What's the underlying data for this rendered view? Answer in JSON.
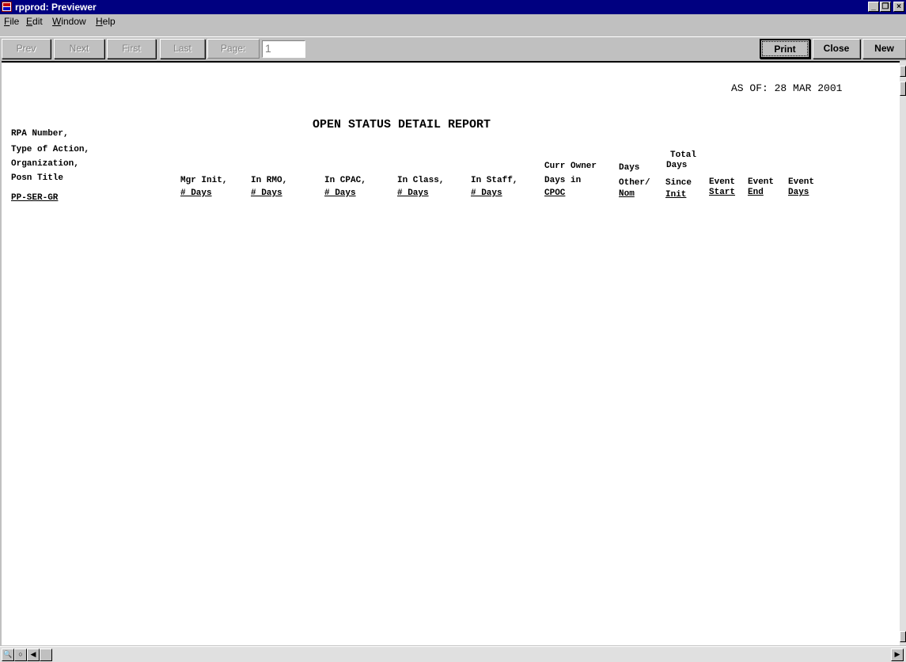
{
  "window": {
    "title": "rpprod: Previewer",
    "controls": {
      "minimize": "_",
      "restore": "❐",
      "close": "×"
    }
  },
  "menu": [
    {
      "label": "File",
      "accel": "F",
      "rest": "ile"
    },
    {
      "label": "Edit",
      "accel": "E",
      "rest": "dit"
    },
    {
      "label": "Window",
      "accel": "W",
      "rest": "indow"
    },
    {
      "label": "Help",
      "accel": "H",
      "rest": "elp"
    }
  ],
  "toolbar": {
    "prev": "Prev",
    "next": "Next",
    "first": "First",
    "last": "Last",
    "page_label": "Page:",
    "page_value": "1",
    "print": "Print",
    "close": "Close",
    "new": "New"
  },
  "report": {
    "as_of": "AS OF:  28 MAR 2001",
    "title": "OPEN STATUS DETAIL REPORT",
    "left_headers": [
      "RPA Number,",
      "Type of Action,",
      "Organization,",
      "Posn Title",
      "PP-SER-GR"
    ],
    "columns": [
      {
        "line1": "Mgr Init,",
        "line2": "# Days"
      },
      {
        "line1": "In RMO,",
        "line2": "# Days"
      },
      {
        "line1": "In CPAC,",
        "line2": "# Days"
      },
      {
        "line1": "In Class,",
        "line2": "# Days"
      },
      {
        "line1": "In Staff,",
        "line2": "# Days"
      },
      {
        "line0": "Curr Owner",
        "line1": "Days in",
        "line2": "CPOC"
      },
      {
        "line0": "Days",
        "line1": "Other/",
        "line2": "Nom"
      },
      {
        "line00": "Total",
        "line0": "Days",
        "line1": "Since",
        "line2": "Init"
      },
      {
        "line1": "Event",
        "line2": "Start"
      },
      {
        "line1": "Event",
        "line2": "End"
      },
      {
        "line1": "Event",
        "line2": "Days"
      }
    ]
  },
  "statusbar": {
    "zoom_in": "🔍",
    "zoom_out": "○",
    "scroll_left": "◀",
    "scroll_right": "▶"
  }
}
